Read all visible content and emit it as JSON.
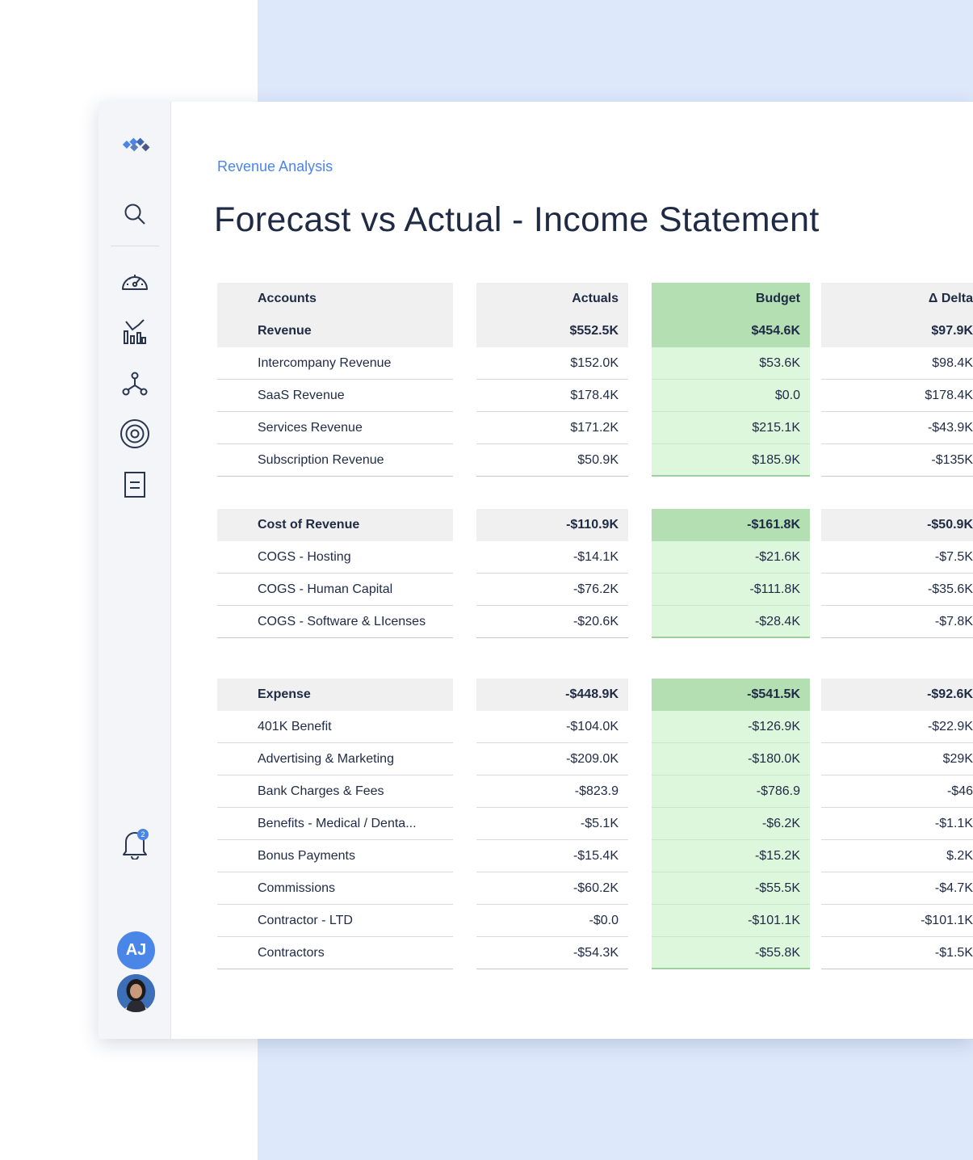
{
  "breadcrumb": "Revenue Analysis",
  "title": "Forecast vs Actual - Income Statement",
  "notifications": {
    "count": "2"
  },
  "user": {
    "initials": "AJ"
  },
  "sidebar": {
    "items": [
      {
        "icon": "search-icon"
      },
      {
        "icon": "dashboard-gauge-icon"
      },
      {
        "icon": "chart-icon"
      },
      {
        "icon": "network-icon"
      },
      {
        "icon": "target-icon"
      },
      {
        "icon": "document-icon"
      }
    ]
  },
  "colors": {
    "accent": "#4a86e8",
    "budget_head": "#b3dfb3",
    "budget_cell": "#dcf7dc",
    "bg_blue": "#dde8fb"
  },
  "table": {
    "headers": {
      "accounts": "Accounts",
      "actuals": "Actuals",
      "budget": "Budget",
      "delta": "Δ Delta"
    },
    "rows": [
      {
        "type": "section",
        "account": "Revenue",
        "actuals": "$552.5K",
        "budget": "$454.6K",
        "delta": "$97.9K"
      },
      {
        "type": "row",
        "account": "Intercompany Revenue",
        "actuals": "$152.0K",
        "budget": "$53.6K",
        "delta": "$98.4K"
      },
      {
        "type": "row",
        "account": "SaaS Revenue",
        "actuals": "$178.4K",
        "budget": "$0.0",
        "delta": "$178.4K"
      },
      {
        "type": "row",
        "account": "Services Revenue",
        "actuals": "$171.2K",
        "budget": "$215.1K",
        "delta": "-$43.9K"
      },
      {
        "type": "row",
        "account": "Subscription Revenue",
        "actuals": "$50.9K",
        "budget": "$185.9K",
        "delta": "-$135K"
      },
      {
        "type": "spacer"
      },
      {
        "type": "section",
        "account": "Cost of Revenue",
        "actuals": "-$110.9K",
        "budget": "-$161.8K",
        "delta": "-$50.9K"
      },
      {
        "type": "row",
        "account": "COGS - Hosting",
        "actuals": "-$14.1K",
        "budget": "-$21.6K",
        "delta": "-$7.5K"
      },
      {
        "type": "row",
        "account": "COGS - Human Capital",
        "actuals": "-$76.2K",
        "budget": "-$111.8K",
        "delta": "-$35.6K"
      },
      {
        "type": "row",
        "account": "COGS - Software & LIcenses",
        "actuals": "-$20.6K",
        "budget": "-$28.4K",
        "delta": "-$7.8K"
      },
      {
        "type": "spacer2"
      },
      {
        "type": "section",
        "account": "Expense",
        "actuals": "-$448.9K",
        "budget": "-$541.5K",
        "delta": "-$92.6K"
      },
      {
        "type": "row",
        "account": "401K Benefit",
        "actuals": "-$104.0K",
        "budget": "-$126.9K",
        "delta": "-$22.9K"
      },
      {
        "type": "row",
        "account": "Advertising & Marketing",
        "actuals": "-$209.0K",
        "budget": "-$180.0K",
        "delta": "$29K"
      },
      {
        "type": "row",
        "account": "Bank Charges & Fees",
        "actuals": "-$823.9",
        "budget": "-$786.9",
        "delta": "-$46"
      },
      {
        "type": "row",
        "account": "Benefits - Medical / Denta...",
        "actuals": "-$5.1K",
        "budget": "-$6.2K",
        "delta": "-$1.1K"
      },
      {
        "type": "row",
        "account": "Bonus Payments",
        "actuals": "-$15.4K",
        "budget": "-$15.2K",
        "delta": "$.2K"
      },
      {
        "type": "row",
        "account": "Commissions",
        "actuals": "-$60.2K",
        "budget": "-$55.5K",
        "delta": "-$4.7K"
      },
      {
        "type": "row",
        "account": "Contractor - LTD",
        "actuals": "-$0.0",
        "budget": "-$101.1K",
        "delta": "-$101.1K"
      },
      {
        "type": "row",
        "account": "Contractors",
        "actuals": "-$54.3K",
        "budget": "-$55.8K",
        "delta": "-$1.5K"
      }
    ]
  }
}
